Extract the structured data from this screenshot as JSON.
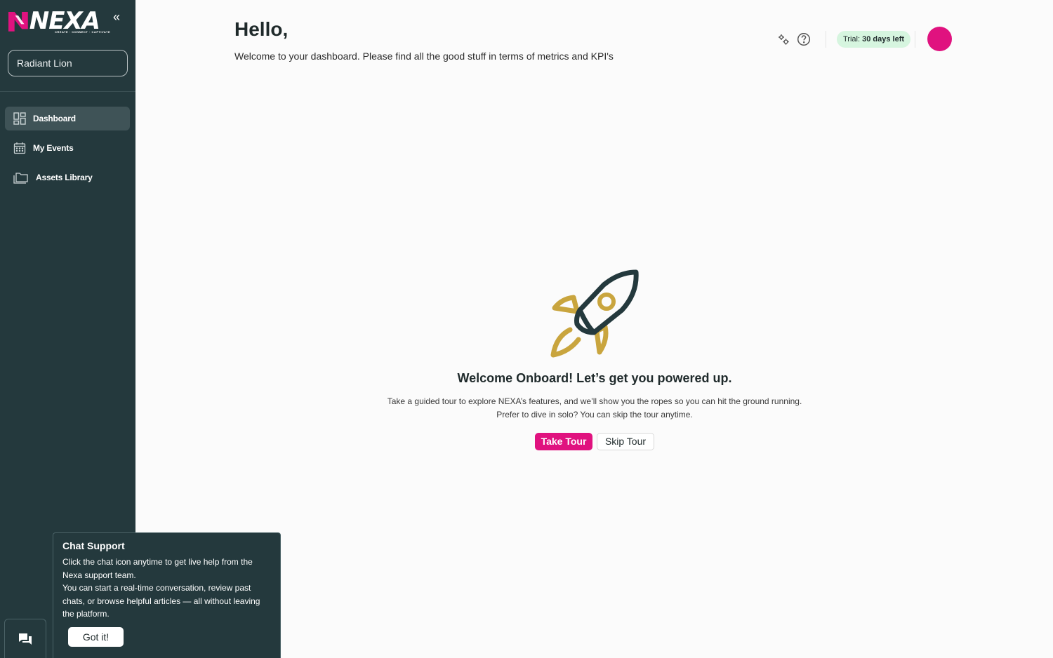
{
  "brand": {
    "name": "NEXA",
    "tagline": "CREATE · CONNECT · CAPTIVATE",
    "accent": "#e0127f",
    "sidebar_bg": "#24393d"
  },
  "sidebar": {
    "workspace": "Radiant Lion",
    "items": [
      {
        "label": "Dashboard",
        "icon": "dashboard-icon",
        "active": true
      },
      {
        "label": "My Events",
        "icon": "calendar-icon",
        "active": false
      },
      {
        "label": "Assets Library",
        "icon": "folder-icon",
        "active": false
      }
    ]
  },
  "header": {
    "greeting": "Hello,",
    "subtitle": "Welcome to your dashboard. Please find all the good stuff in terms of metrics and KPI's",
    "trial_prefix": "Trial:",
    "trial_value": "30 days left"
  },
  "onboarding": {
    "title": "Welcome Onboard! Let’s get you powered up.",
    "line1": "Take a guided tour to explore NEXA’s features, and we’ll show you the ropes so you can hit the ground running.",
    "line2": "Prefer to dive in solo? You can skip the tour anytime.",
    "take_tour": "Take Tour",
    "skip_tour": "Skip Tour"
  },
  "chat_tip": {
    "title": "Chat Support",
    "line1": "Click the chat icon anytime to get live help from the Nexa support team.",
    "line2": "You can start a real-time conversation, review past chats, or browse helpful articles — all without leaving the platform.",
    "button": "Got it!"
  }
}
